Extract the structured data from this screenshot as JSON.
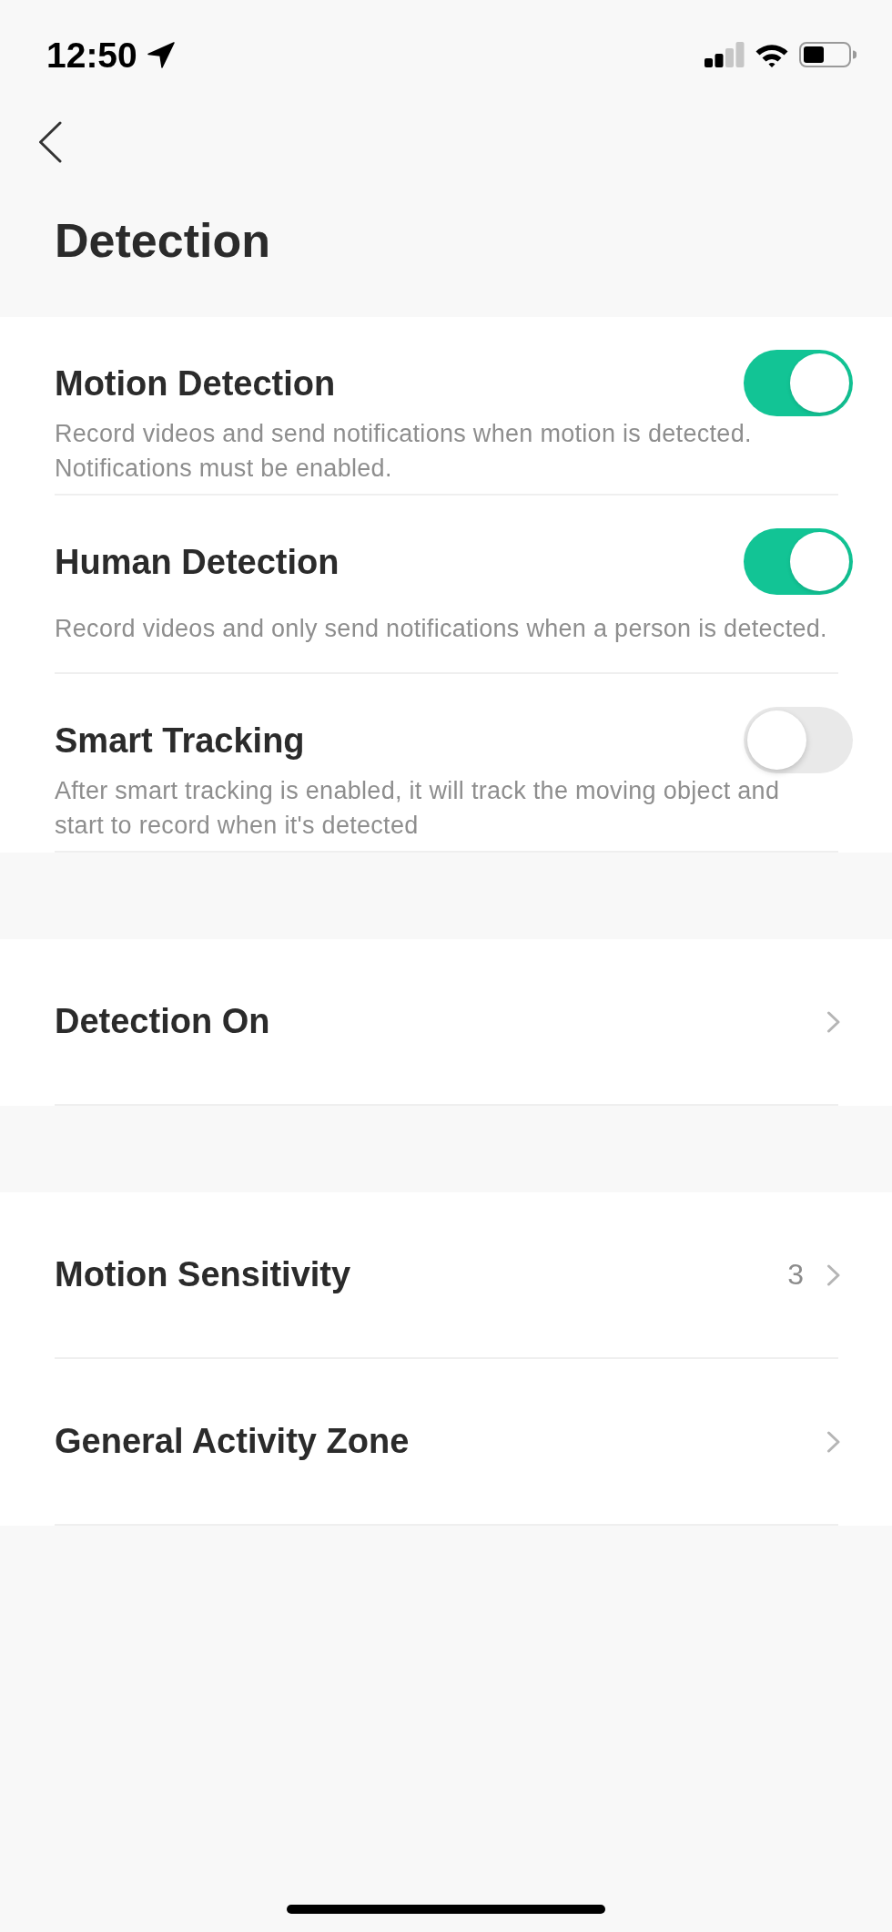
{
  "status_bar": {
    "time": "12:50"
  },
  "header": {
    "title": "Detection"
  },
  "sections": [
    {
      "rows": [
        {
          "kind": "toggle",
          "title": "Motion Detection",
          "description": "Record videos and send notifications when motion is detected. Notifications must be enabled.",
          "on": true
        },
        {
          "kind": "toggle",
          "title": "Human Detection",
          "description": "Record videos and only send notifications when a person is detected.",
          "on": true
        },
        {
          "kind": "toggle",
          "title": "Smart Tracking",
          "description": "After smart tracking is enabled, it will track the moving object and start to record when it's detected",
          "on": false
        }
      ]
    },
    {
      "rows": [
        {
          "kind": "link",
          "title": "Detection On"
        }
      ]
    },
    {
      "rows": [
        {
          "kind": "link",
          "title": "Motion Sensitivity",
          "value": "3"
        },
        {
          "kind": "link",
          "title": "General Activity Zone"
        }
      ]
    }
  ]
}
